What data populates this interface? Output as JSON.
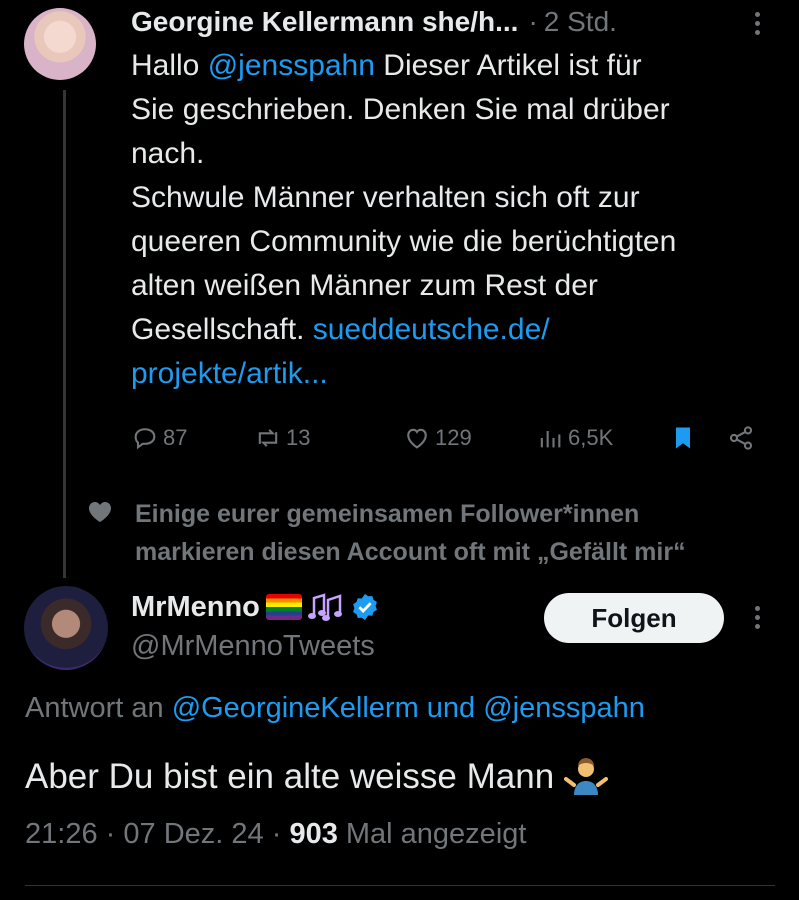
{
  "tweet1": {
    "author_name": "Georgine Kellermann she/h...",
    "separator": "·",
    "time_ago": "2 Std.",
    "text_lines": [
      {
        "parts": [
          {
            "t": "Hallo "
          },
          {
            "t": "@jensspahn",
            "mention": true
          },
          {
            "t": " Dieser Artikel ist für"
          }
        ]
      },
      {
        "parts": [
          {
            "t": "Sie geschrieben. Denken Sie mal drüber"
          }
        ]
      },
      {
        "parts": [
          {
            "t": "nach."
          }
        ]
      },
      {
        "parts": [
          {
            "t": "Schwule Männer verhalten sich oft zur"
          }
        ]
      },
      {
        "parts": [
          {
            "t": "queeren Community wie die berüchtigten"
          }
        ]
      },
      {
        "parts": [
          {
            "t": "alten weißen Männer zum Rest der"
          }
        ]
      },
      {
        "parts": [
          {
            "t": "Gesellschaft.  "
          },
          {
            "t": "sueddeutsche.de/",
            "link": true
          }
        ]
      },
      {
        "parts": [
          {
            "t": "projekte/artik...",
            "link": true
          }
        ]
      }
    ],
    "actions": {
      "replies": "87",
      "retweets": "13",
      "likes": "129",
      "views": "6,5K"
    },
    "bookmark_color": "#1d9bf0"
  },
  "social_context": {
    "line1": "Einige eurer gemeinsamen Follower*innen",
    "line2": "markieren diesen Account oft mit „Gefällt mir“"
  },
  "tweet2": {
    "author_name": "MrMenno",
    "handle": "@MrMennoTweets",
    "follow_label": "Folgen",
    "reply_prefix": "Antwort an ",
    "reply_mention_1": "@GeorgineKellerm",
    "reply_conj": " und ",
    "reply_mention_2": "@jensspahn",
    "text": "Aber Du bist ein alte weisse Mann",
    "time": "21:26",
    "dot": "·",
    "date": "07 Dez. 24",
    "views_count": "903",
    "views_label": " Mal angezeigt"
  },
  "icons": {
    "reply": "reply-icon",
    "retweet": "retweet-icon",
    "like": "heart-icon",
    "views": "views-icon",
    "bookmark": "bookmark-icon",
    "share": "share-icon",
    "verified": "verified-badge-icon",
    "emoji_flag": "rainbow-flag-icon",
    "emoji_notes": "musical-notes-icon",
    "emoji_shrug": "shrug-icon"
  },
  "colors": {
    "background": "#000000",
    "text": "#e7e9ea",
    "muted": "#71767b",
    "accent": "#1d9bf0",
    "button_bg": "#eff3f4"
  }
}
